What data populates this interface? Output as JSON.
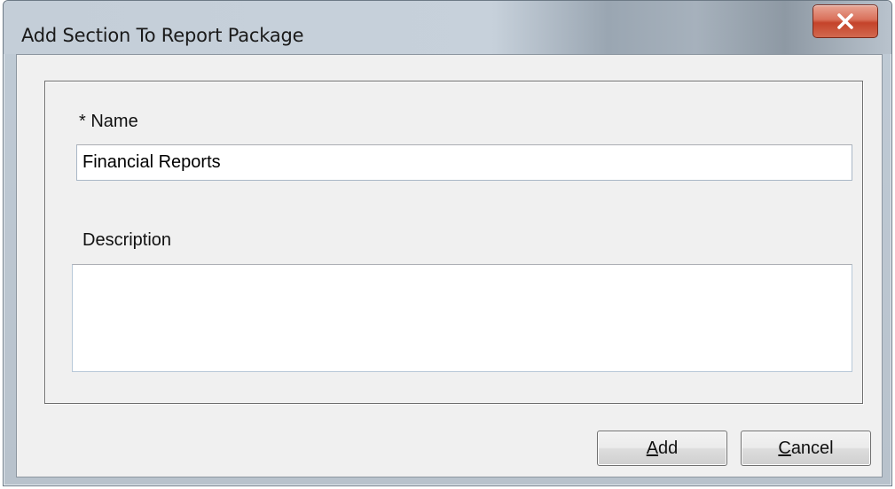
{
  "window": {
    "title": "Add Section To Report Package"
  },
  "form": {
    "name_label": "* Name",
    "name_value": "Financial Reports",
    "description_label": "Description",
    "description_value": ""
  },
  "buttons": {
    "add": {
      "accel": "A",
      "rest": "dd"
    },
    "cancel": {
      "accel": "C",
      "rest": "ancel"
    }
  },
  "icons": {
    "close": "close-icon"
  },
  "colors": {
    "close_button": "#c4432a",
    "dialog_background": "#f0f0f0"
  }
}
